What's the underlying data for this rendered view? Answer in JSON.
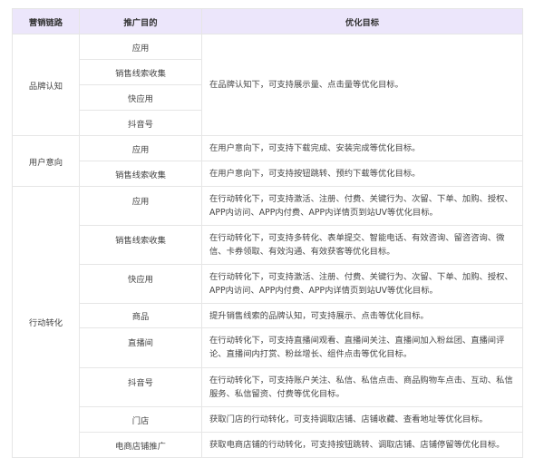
{
  "headers": [
    "营销链路",
    "推广目的",
    "优化目标"
  ],
  "groups": [
    {
      "stage": "品牌认知",
      "shared_goal": "在品牌认知下，可支持展示量、点击量等优化目标。",
      "purposes": [
        "应用",
        "销售线索收集",
        "快应用",
        "抖音号"
      ]
    },
    {
      "stage": "用户意向",
      "rows": [
        {
          "purpose": "应用",
          "goal": "在用户意向下，可支持下载完成、安装完成等优化目标。"
        },
        {
          "purpose": "销售线索收集",
          "goal": "在用户意向下，可支持按钮跳转、预约下载等优化目标。"
        }
      ]
    },
    {
      "stage": "行动转化",
      "rows": [
        {
          "purpose": "应用",
          "goal": "在行动转化下，可支持激活、注册、付费、关键行为、次留、下单、加购、授权、APP内访问、APP内付费、APP内详情页到站UV等优化目标。"
        },
        {
          "purpose": "销售线索收集",
          "goal": "在行动转化下，可支持多转化、表单提交、智能电话、有效咨询、留咨咨询、微信、卡券领取、有效沟通、有效获客等优化目标。"
        },
        {
          "purpose": "快应用",
          "goal": "在行动转化下，可支持激活、注册、付费、关键行为、次留、下单、加购、授权、APP内访问、APP内付费、APP内详情页到站UV等优化目标。"
        },
        {
          "purpose": "商品",
          "goal": "提升销售线索的品牌认知，可支持展示、点击等优化目标。"
        },
        {
          "purpose": "直播间",
          "goal": "在行动转化下，可支持直播间观看、直播间关注、直播间加入粉丝团、直播间评论、直播间内打赏、粉丝增长、组件点击等优化目标。"
        },
        {
          "purpose": "抖音号",
          "goal": "在行动转化下，可支持账户关注、私信、私信点击、商品购物车点击、互动、私信服务、私信留资、付费等优化目标。"
        },
        {
          "purpose": "门店",
          "goal": "获取门店的行动转化，可支持调取店铺、店铺收藏、查看地址等优化目标。"
        },
        {
          "purpose": "电商店铺推广",
          "goal": "获取电商店铺的行动转化，可支持按钮跳转、调取店铺、店铺停留等优化目标。"
        }
      ]
    }
  ]
}
